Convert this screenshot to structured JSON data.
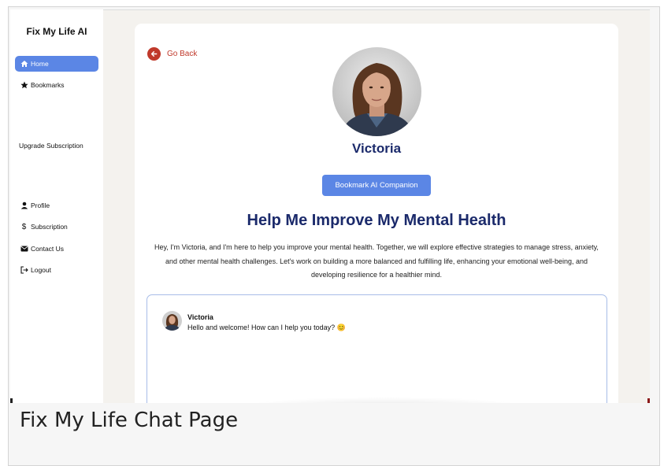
{
  "sidebar": {
    "brand": "Fix My Life AI",
    "nav": [
      {
        "label": "Home",
        "icon": "home-icon",
        "active": true
      },
      {
        "label": "Bookmarks",
        "icon": "star-icon",
        "active": false
      }
    ],
    "upgrade": "Upgrade Subscription",
    "account": [
      {
        "label": "Profile",
        "icon": "user-icon"
      },
      {
        "label": "Subscription",
        "icon": "dollar-icon"
      },
      {
        "label": "Contact Us",
        "icon": "envelope-icon"
      },
      {
        "label": "Logout",
        "icon": "logout-icon"
      }
    ]
  },
  "main": {
    "go_back": "Go Back",
    "companion_name": "Victoria",
    "bookmark_button": "Bookmark AI Companion",
    "headline": "Help Me Improve My Mental Health",
    "intro": "Hey, I'm Victoria, and I'm here to help you improve your mental health. Together, we will explore effective strategies to manage stress, anxiety, and other mental health challenges. Let's work on building a more balanced and fulfilling life, enhancing your emotional well-being, and developing resilience for a healthier mind."
  },
  "chat": {
    "messages": [
      {
        "sender": "Victoria",
        "text": "Hello and welcome! How can I help you today? 😊"
      }
    ]
  },
  "caption": "Fix My Life Chat Page",
  "colors": {
    "accent": "#5b86e5",
    "heading": "#1b2a6b",
    "back": "#c0392b",
    "chat_border": "#a8bde8"
  }
}
